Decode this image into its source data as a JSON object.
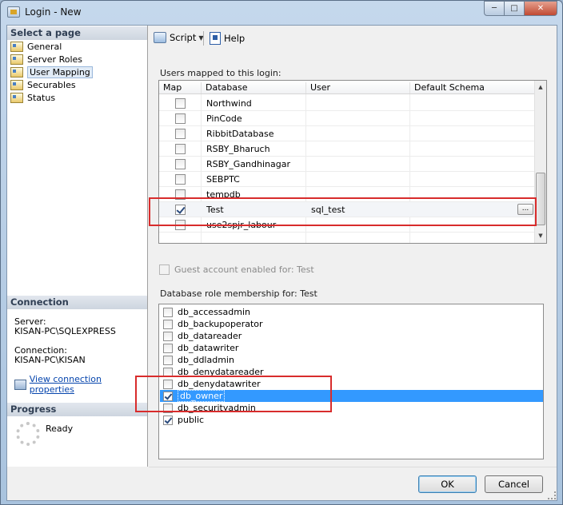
{
  "window": {
    "title": "Login - New",
    "controls": {
      "minimize": "─",
      "maximize": "□",
      "close": "✕"
    }
  },
  "left": {
    "select_page_header": "Select a page",
    "pages": [
      "General",
      "Server Roles",
      "User Mapping",
      "Securables",
      "Status"
    ],
    "selected_page": "User Mapping",
    "connection_header": "Connection",
    "server_label": "Server:",
    "server_value": "KISAN-PC\\SQLEXPRESS",
    "connection_label": "Connection:",
    "connection_value": "KISAN-PC\\KISAN",
    "view_connection_link": "View connection properties",
    "progress_header": "Progress",
    "progress_status": "Ready"
  },
  "toolbar": {
    "script_label": "Script",
    "script_chevron": "▼",
    "help_label": "Help"
  },
  "mapping": {
    "group_label": "Users mapped to this login:",
    "columns": [
      "Map",
      "Database",
      "User",
      "Default Schema"
    ],
    "ellipsis_label": "...",
    "rows": [
      {
        "checked": false,
        "database": "Northwind",
        "user": "",
        "schema": ""
      },
      {
        "checked": false,
        "database": "PinCode",
        "user": "",
        "schema": ""
      },
      {
        "checked": false,
        "database": "RibbitDatabase",
        "user": "",
        "schema": ""
      },
      {
        "checked": false,
        "database": "RSBY_Bharuch",
        "user": "",
        "schema": ""
      },
      {
        "checked": false,
        "database": "RSBY_Gandhinagar",
        "user": "",
        "schema": ""
      },
      {
        "checked": false,
        "database": "SEBPTC",
        "user": "",
        "schema": ""
      },
      {
        "checked": false,
        "database": "tempdb",
        "user": "",
        "schema": ""
      },
      {
        "checked": true,
        "database": "Test",
        "user": "sql_test",
        "schema": "",
        "selected": true
      },
      {
        "checked": false,
        "database": "use2spjr_labour",
        "user": "",
        "schema": ""
      }
    ],
    "scroll_up": "▲",
    "scroll_down": "▼"
  },
  "guest": {
    "label": "Guest account enabled for: Test"
  },
  "roles": {
    "group_label": "Database role membership for: Test",
    "items": [
      {
        "name": "db_accessadmin",
        "checked": false
      },
      {
        "name": "db_backupoperator",
        "checked": false
      },
      {
        "name": "db_datareader",
        "checked": false
      },
      {
        "name": "db_datawriter",
        "checked": false
      },
      {
        "name": "db_ddladmin",
        "checked": false
      },
      {
        "name": "db_denydatareader",
        "checked": false
      },
      {
        "name": "db_denydatawriter",
        "checked": false
      },
      {
        "name": "db_owner",
        "checked": true,
        "selected": true
      },
      {
        "name": "db_securityadmin",
        "checked": false
      },
      {
        "name": "public",
        "checked": true
      }
    ]
  },
  "buttons": {
    "ok": "OK",
    "cancel": "Cancel"
  },
  "colors": {
    "selection": "#3399ff",
    "highlight_box": "#d82c2c",
    "link": "#0645ad"
  }
}
